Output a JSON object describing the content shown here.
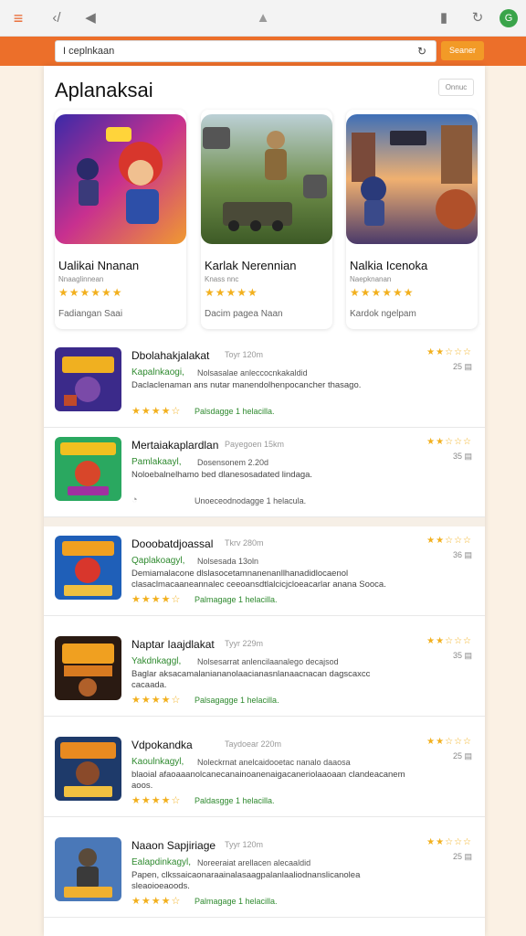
{
  "browser": {
    "menu_icon": "≡",
    "back_icon": "‹/",
    "fwd_icon": "◀",
    "lock_icon": "▲",
    "ext_icon": "▮",
    "refresh_icon": "↻",
    "profile_letter": "G"
  },
  "search": {
    "value": "I ceplnkaan",
    "mic_icon": "↻",
    "button": "Seaner"
  },
  "panel": {
    "title": "Aplanaksai",
    "more_button": "Onnuc"
  },
  "featured": [
    {
      "name": "Ualikai Nnanan",
      "sub": "Nnaaglinnean",
      "stars": "★★★★★★",
      "meta": "Fadiangan Saai"
    },
    {
      "name": "Karlak Nerennian",
      "sub": "Knass nnc",
      "stars": "★★★★★",
      "meta": "Dacim pagea Naan"
    },
    {
      "name": "Nalkia Icenoka",
      "sub": "Naepknanan",
      "stars": "★★★★★★",
      "meta": "Kardok ngelpam"
    }
  ],
  "list": [
    {
      "title": "Dbolahakjalakat",
      "size": "Toyr 120m",
      "dev": "Kapalnkaogi,",
      "dev_note": "Nolsasalae anleccocnkakaldid",
      "desc": "Daclaclenaman ans nutar manendolhenpocancher thasago.",
      "stars": "★★★★☆",
      "pkg": "Palsdagge 1 helacilla.",
      "rate": "★★☆☆☆",
      "count": "25 ▤"
    },
    {
      "title": "Mertaiakaplardlan",
      "size": "Payegoen 15km",
      "dev": "Pamlakaayl,",
      "dev_note": "Dosensonem 2.20d",
      "desc": "Noloebalnelhamo bed dlanesosadated lindaga.",
      "stars": "◔",
      "pkg": "Unoeceodnodagge 1 helacula.",
      "rate": "★★☆☆☆",
      "count": "35 ▤"
    },
    {
      "title": "Dooobatdjoassal",
      "size": "Tkrv 280m",
      "dev": "Qaplakoagyl,",
      "dev_note": "Nolsesada 13oln",
      "desc": "Demiamalacone dlslasocetamnanenanllhanadidlocaenol clasaclmacaaneannalec ceeoansdtlalcicjcloeacarlar anana Sooca.",
      "stars": "★★★★☆",
      "pkg": "Palmagage 1 helacilla.",
      "rate": "★★☆☆☆",
      "count": "36 ▤"
    },
    {
      "title": "Naptar Iaajdlakat",
      "size": "Tyyr 229m",
      "dev": "Yakdnkaggl,",
      "dev_note": "Nolsesarrat anlencilaanalego decajsod",
      "desc": "Baglar aksacamalaniananolaacianasnlanaacnacan dagscaxcc cacaada.",
      "stars": "★★★★☆",
      "pkg": "Palsagagge 1 helacilla.",
      "rate": "★★☆☆☆",
      "count": "35 ▤"
    },
    {
      "title": "Vdpokandka",
      "size": "Taydoear 220m",
      "dev": "Kaoulnkagyl,",
      "dev_note": "Noleckrnat anelcaidooetac nanalo daaosa",
      "desc": "blaoial afaoaaanolcanecanainoanenaigacaneriolaaoaan clandeacanem aoos.",
      "stars": "★★★★☆",
      "pkg": "Paldasgge 1 helacilla.",
      "rate": "★★☆☆☆",
      "count": "25 ▤"
    },
    {
      "title": "Naaon Sapjiriage",
      "size": "Tyyr 120m",
      "dev": "Ealapdinkagyl,",
      "dev_note": "Noreeraiat arellacen alecaaldid",
      "desc": "Papen, clkssaicaonaraainalasaagpalanlaaliodnanslicanolea sleaoioeaoods.",
      "stars": "★★★★☆",
      "pkg": "Palmagage 1 helacilla.",
      "rate": "★★☆☆☆",
      "count": "25 ▤"
    }
  ],
  "colors": {
    "orange": "#ec6f2a",
    "button": "#f29a27",
    "green": "#2f8a2f",
    "star": "#f2b01e"
  }
}
